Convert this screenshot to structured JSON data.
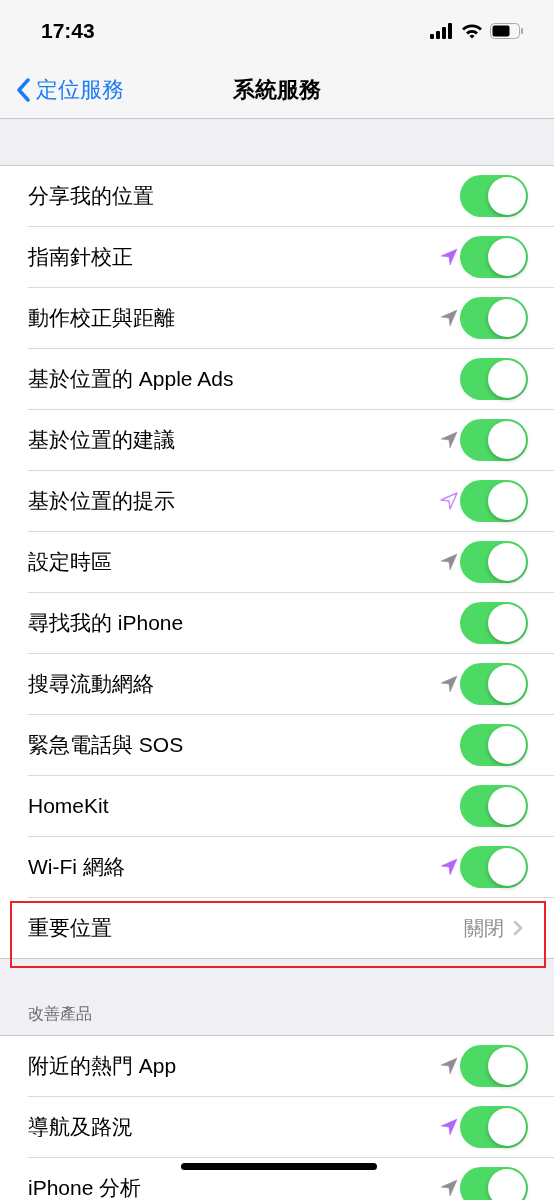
{
  "status_bar": {
    "time": "17:43"
  },
  "nav": {
    "back": "定位服務",
    "title": "系統服務"
  },
  "sections": [
    {
      "rows": [
        {
          "kind": "toggle",
          "label": "分享我的位置",
          "on": true
        },
        {
          "kind": "toggle",
          "label": "指南針校正",
          "on": true,
          "location_icon": {
            "kind": "filled",
            "color": "#b066f7"
          }
        },
        {
          "kind": "toggle",
          "label": "動作校正與距離",
          "on": true,
          "location_icon": {
            "kind": "filled",
            "color": "#8e8e93"
          }
        },
        {
          "kind": "toggle",
          "label": "基於位置的 Apple Ads",
          "on": true
        },
        {
          "kind": "toggle",
          "label": "基於位置的建議",
          "on": true,
          "location_icon": {
            "kind": "filled",
            "color": "#8e8e93"
          }
        },
        {
          "kind": "toggle",
          "label": "基於位置的提示",
          "on": true,
          "location_icon": {
            "kind": "outline",
            "color": "#c68cf9"
          }
        },
        {
          "kind": "toggle",
          "label": "設定時區",
          "on": true,
          "location_icon": {
            "kind": "filled",
            "color": "#8e8e93"
          }
        },
        {
          "kind": "toggle",
          "label": "尋找我的 iPhone",
          "on": true
        },
        {
          "kind": "toggle",
          "label": "搜尋流動網絡",
          "on": true,
          "location_icon": {
            "kind": "filled",
            "color": "#8e8e93"
          }
        },
        {
          "kind": "toggle",
          "label": "緊急電話與 SOS",
          "on": true
        },
        {
          "kind": "toggle",
          "label": "HomeKit",
          "on": true
        },
        {
          "kind": "toggle",
          "label": "Wi-Fi 網絡",
          "on": true,
          "location_icon": {
            "kind": "filled",
            "color": "#b066f7"
          }
        },
        {
          "kind": "link",
          "label": "重要位置",
          "value": "關閉",
          "highlighted": true
        }
      ]
    },
    {
      "header": "改善產品",
      "rows": [
        {
          "kind": "toggle",
          "label": "附近的熱門 App",
          "on": true,
          "location_icon": {
            "kind": "filled",
            "color": "#8e8e93"
          }
        },
        {
          "kind": "toggle",
          "label": "導航及路況",
          "on": true,
          "location_icon": {
            "kind": "filled",
            "color": "#b066f7"
          }
        },
        {
          "kind": "toggle",
          "label": "iPhone 分析",
          "on": true,
          "location_icon": {
            "kind": "filled",
            "color": "#8e8e93"
          }
        }
      ]
    }
  ]
}
